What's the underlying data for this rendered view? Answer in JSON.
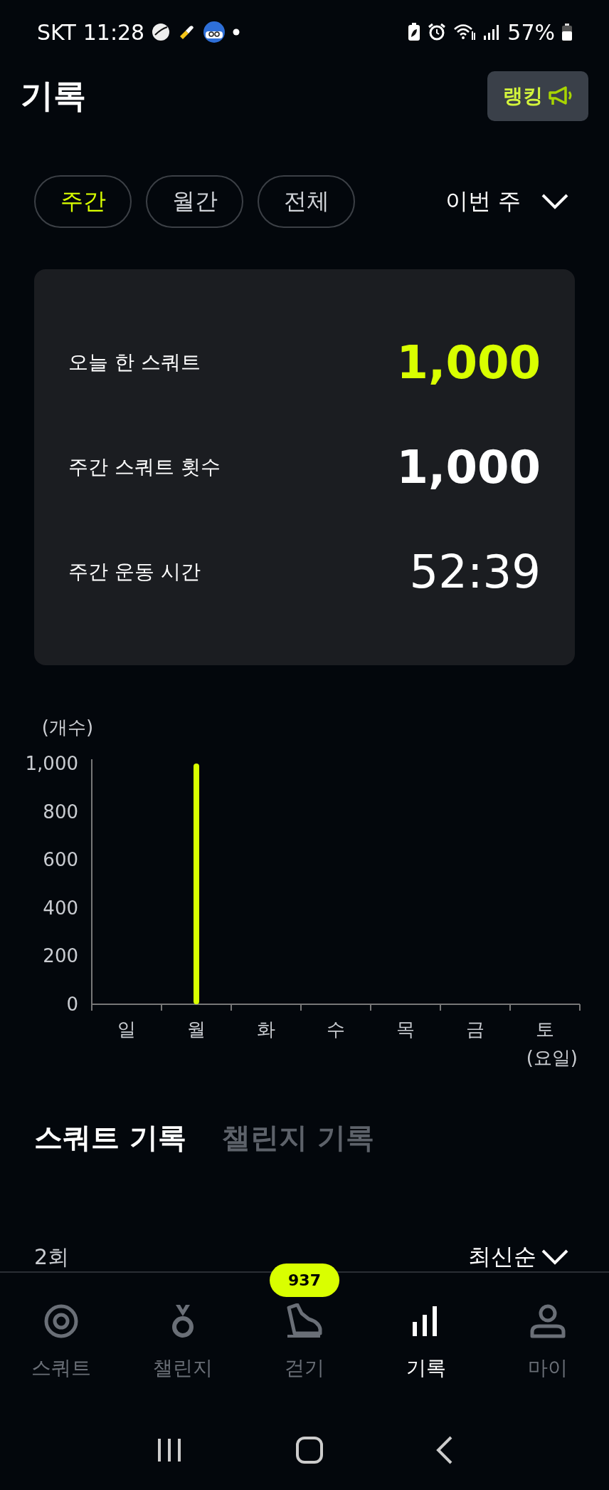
{
  "status_bar": {
    "carrier": "SKT",
    "time": "11:28",
    "battery": "57%"
  },
  "header": {
    "title": "기록",
    "ranking_button": "랭킹"
  },
  "period_tabs": [
    {
      "label": "주간",
      "selected": true
    },
    {
      "label": "월간",
      "selected": false
    },
    {
      "label": "전체",
      "selected": false
    }
  ],
  "period_dropdown": "이번 주",
  "summary": [
    {
      "label": "오늘 한 스쿼트",
      "value": "1,000",
      "kind": "highlight"
    },
    {
      "label": "주간 스쿼트 횟수",
      "value": "1,000",
      "kind": "bold"
    },
    {
      "label": "주간 운동 시간",
      "value": "52:39",
      "kind": "regular"
    }
  ],
  "chart_data": {
    "type": "bar",
    "ylabel": "(개수)",
    "xlabel": "(요일)",
    "categories": [
      "일",
      "월",
      "화",
      "수",
      "목",
      "금",
      "토"
    ],
    "series": [
      {
        "color": "#d9ff00",
        "values": [
          0,
          1000,
          0,
          0,
          0,
          0,
          0
        ]
      }
    ],
    "ylim": [
      0,
      1000
    ],
    "yticks": [
      0,
      200,
      400,
      600,
      800,
      {
        "value": 1000,
        "label": "1,000"
      }
    ]
  },
  "record_tabs": [
    {
      "label": "스쿼트 기록",
      "selected": true
    },
    {
      "label": "챌린지 기록",
      "selected": false
    }
  ],
  "record_count": "2회",
  "sort": "최신순",
  "bottom_nav": [
    {
      "label": "스쿼트",
      "selected": false
    },
    {
      "label": "챌린지",
      "selected": false
    },
    {
      "label": "걷기",
      "selected": false,
      "badge": "937"
    },
    {
      "label": "기록",
      "selected": true
    },
    {
      "label": "마이",
      "selected": false
    }
  ]
}
